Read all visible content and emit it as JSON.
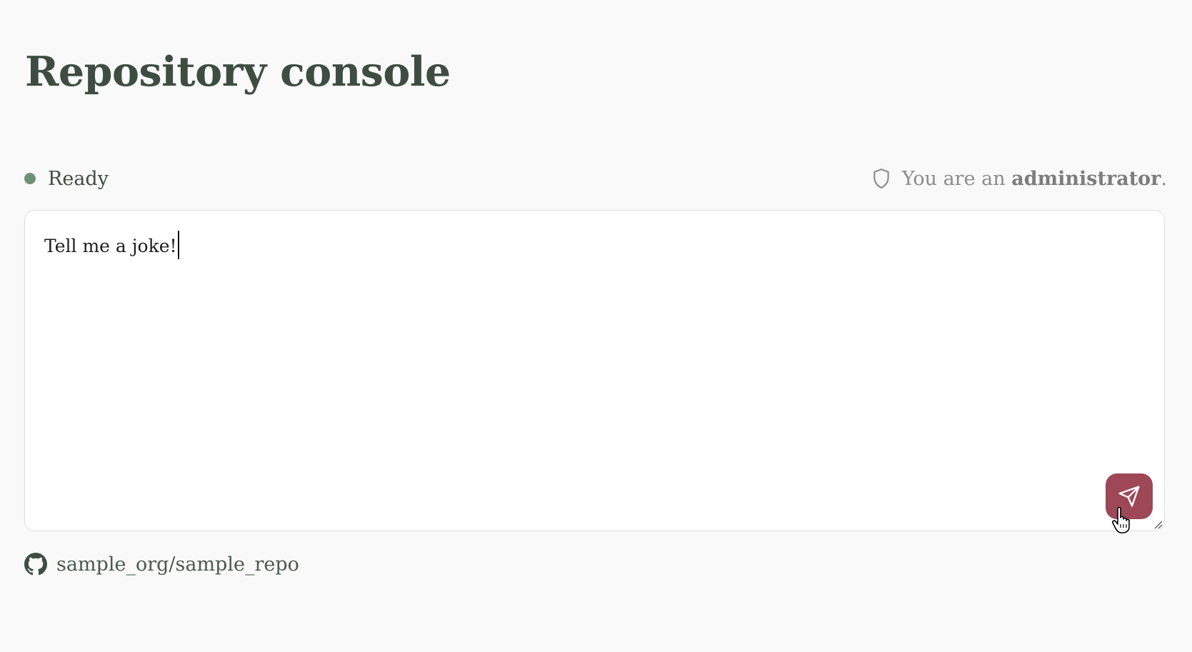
{
  "page": {
    "title": "Repository console"
  },
  "status": {
    "label": "Ready",
    "color": "#6e9174"
  },
  "role": {
    "prefix": "You are an",
    "role_name": "administrator",
    "suffix": ".",
    "icon": "shield-icon"
  },
  "composer": {
    "value": "Tell me a joke!",
    "send_icon": "send-icon",
    "send_color": "#9e4757"
  },
  "repo": {
    "name": "sample_org/sample_repo",
    "icon": "github-icon"
  }
}
